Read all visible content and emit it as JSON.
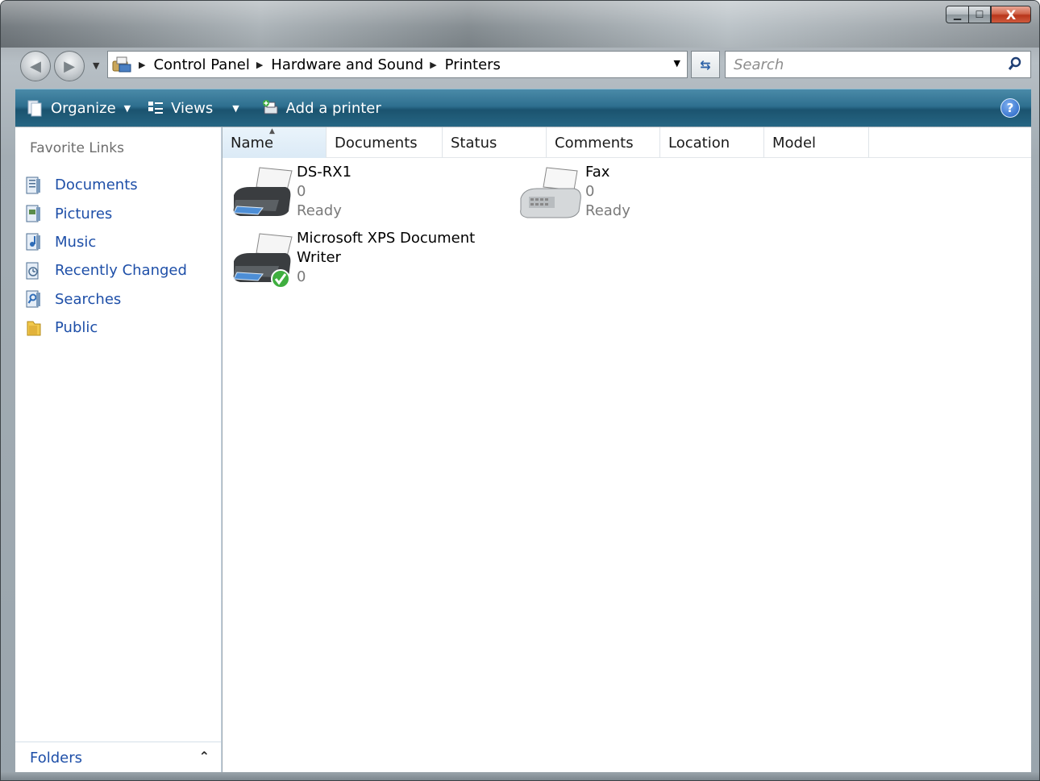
{
  "window": {
    "controls": {
      "minimize": "▁",
      "maximize": "☐",
      "close": "X"
    }
  },
  "address": {
    "crumbs": [
      "Control Panel",
      "Hardware and Sound",
      "Printers"
    ]
  },
  "search": {
    "placeholder": "Search"
  },
  "toolbar": {
    "organize_label": "Organize",
    "views_label": "Views",
    "add_printer_label": "Add a printer",
    "help_label": "?"
  },
  "sidebar": {
    "title": "Favorite Links",
    "items": [
      {
        "label": "Documents",
        "icon": "documents-icon"
      },
      {
        "label": "Pictures",
        "icon": "pictures-icon"
      },
      {
        "label": "Music",
        "icon": "music-icon"
      },
      {
        "label": "Recently Changed",
        "icon": "recently-changed-icon"
      },
      {
        "label": "Searches",
        "icon": "searches-icon"
      },
      {
        "label": "Public",
        "icon": "public-folder-icon"
      }
    ],
    "folders_label": "Folders"
  },
  "columns": [
    "Name",
    "Documents",
    "Status",
    "Comments",
    "Location",
    "Model"
  ],
  "printers": [
    {
      "name": "DS-RX1",
      "name2": "",
      "documents": "0",
      "status": "Ready",
      "icon": "printer-icon"
    },
    {
      "name": "Fax",
      "name2": "",
      "documents": "0",
      "status": "Ready",
      "icon": "fax-icon"
    },
    {
      "name": "Microsoft XPS Document",
      "name2": "Writer",
      "documents": "0",
      "status": "",
      "icon": "default-printer-icon"
    }
  ],
  "colors": {
    "link": "#1e4fa8",
    "toolbar": "#2e6f8f",
    "muted": "#7a7a7a"
  }
}
